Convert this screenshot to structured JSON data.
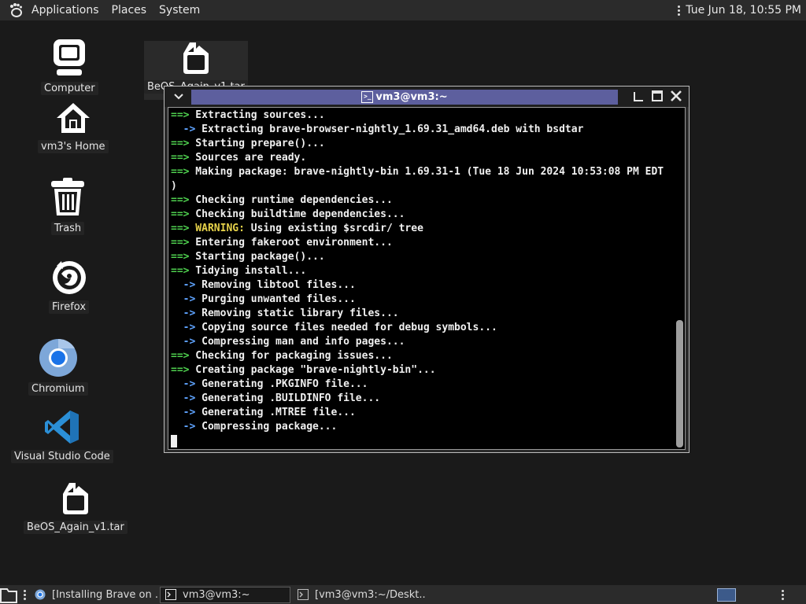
{
  "top_panel": {
    "menus": [
      "Applications",
      "Places",
      "System"
    ],
    "clock": "Tue Jun 18, 10:55 PM"
  },
  "desktop_icons": [
    {
      "label": "Computer",
      "icon": "computer-icon"
    },
    {
      "label": "vm3's Home",
      "icon": "home-icon"
    },
    {
      "label": "Trash",
      "icon": "trash-icon"
    },
    {
      "label": "Firefox",
      "icon": "firefox-icon"
    },
    {
      "label": "Chromium",
      "icon": "chromium-icon"
    },
    {
      "label": "Visual Studio Code",
      "icon": "vscode-icon"
    },
    {
      "label": "BeOS_Again_v1.tar",
      "icon": "file-icon"
    },
    {
      "label": "BeOS_Again_v1.tar",
      "icon": "file-icon"
    }
  ],
  "terminal": {
    "title": "vm3@vm3:~",
    "lines": [
      {
        "marker": "==>",
        "color": "green",
        "text": " Extracting sources..."
      },
      {
        "marker": "  ->",
        "color": "blue",
        "text": " Extracting brave-browser-nightly_1.69.31_amd64.deb with bsdtar"
      },
      {
        "marker": "==>",
        "color": "green",
        "text": " Starting prepare()..."
      },
      {
        "marker": "==>",
        "color": "green",
        "text": " Sources are ready."
      },
      {
        "marker": "==>",
        "color": "green",
        "text": " Making package: brave-nightly-bin 1.69.31-1 (Tue 18 Jun 2024 10:53:08 PM EDT"
      },
      {
        "marker": "",
        "color": "",
        "text": ")"
      },
      {
        "marker": "==>",
        "color": "green",
        "text": " Checking runtime dependencies..."
      },
      {
        "marker": "==>",
        "color": "green",
        "text": " Checking buildtime dependencies..."
      },
      {
        "marker": "==>",
        "color": "yellow",
        "warn": " WARNING:",
        "text": " Using existing $srcdir/ tree"
      },
      {
        "marker": "==>",
        "color": "green",
        "text": " Entering fakeroot environment..."
      },
      {
        "marker": "==>",
        "color": "green",
        "text": " Starting package()..."
      },
      {
        "marker": "==>",
        "color": "green",
        "text": " Tidying install..."
      },
      {
        "marker": "  ->",
        "color": "blue",
        "text": " Removing libtool files..."
      },
      {
        "marker": "  ->",
        "color": "blue",
        "text": " Purging unwanted files..."
      },
      {
        "marker": "  ->",
        "color": "blue",
        "text": " Removing static library files..."
      },
      {
        "marker": "  ->",
        "color": "blue",
        "text": " Copying source files needed for debug symbols..."
      },
      {
        "marker": "  ->",
        "color": "blue",
        "text": " Compressing man and info pages..."
      },
      {
        "marker": "==>",
        "color": "green",
        "text": " Checking for packaging issues..."
      },
      {
        "marker": "==>",
        "color": "green",
        "text": " Creating package \"brave-nightly-bin\"..."
      },
      {
        "marker": "  ->",
        "color": "blue",
        "text": " Generating .PKGINFO file..."
      },
      {
        "marker": "  ->",
        "color": "blue",
        "text": " Generating .BUILDINFO file..."
      },
      {
        "marker": "  ->",
        "color": "blue",
        "text": " Generating .MTREE file..."
      },
      {
        "marker": "  ->",
        "color": "blue",
        "text": " Compressing package..."
      }
    ]
  },
  "taskbar": {
    "tasks": [
      {
        "label": "[Installing Brave on ...",
        "icon": "browser-icon",
        "active": false
      },
      {
        "label": "vm3@vm3:~",
        "icon": "terminal-icon",
        "active": true
      },
      {
        "label": "[vm3@vm3:~/Deskt...",
        "icon": "terminal-icon",
        "active": false
      }
    ]
  },
  "colors": {
    "marker_green": "#4fd14f",
    "marker_blue": "#5ea3ff",
    "warning_yellow": "#e6d24a",
    "title_bar_active": "#5d5f9e"
  }
}
